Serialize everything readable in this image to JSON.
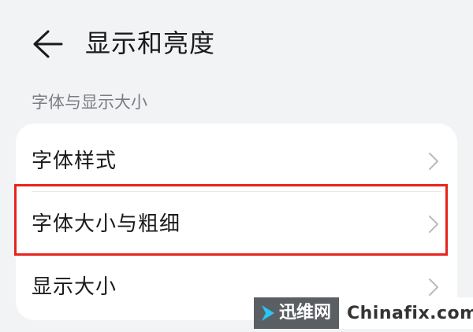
{
  "header": {
    "title": "显示和亮度",
    "back_icon": "arrow-left-icon"
  },
  "section": {
    "label": "字体与显示大小"
  },
  "settings": {
    "items": [
      {
        "label": "字体样式",
        "icon": "chevron-right-icon"
      },
      {
        "label": "字体大小与粗细",
        "icon": "chevron-right-icon",
        "highlighted": true
      },
      {
        "label": "显示大小",
        "icon": "chevron-right-icon"
      }
    ]
  },
  "watermark": {
    "name": "迅维网",
    "domain": "Chinafix.com"
  },
  "colors": {
    "background": "#f1f3f5",
    "card": "#ffffff",
    "highlight": "#e8231b",
    "watermark_dark": "#5a5f64",
    "watermark_arrow": "#29c5f6"
  }
}
